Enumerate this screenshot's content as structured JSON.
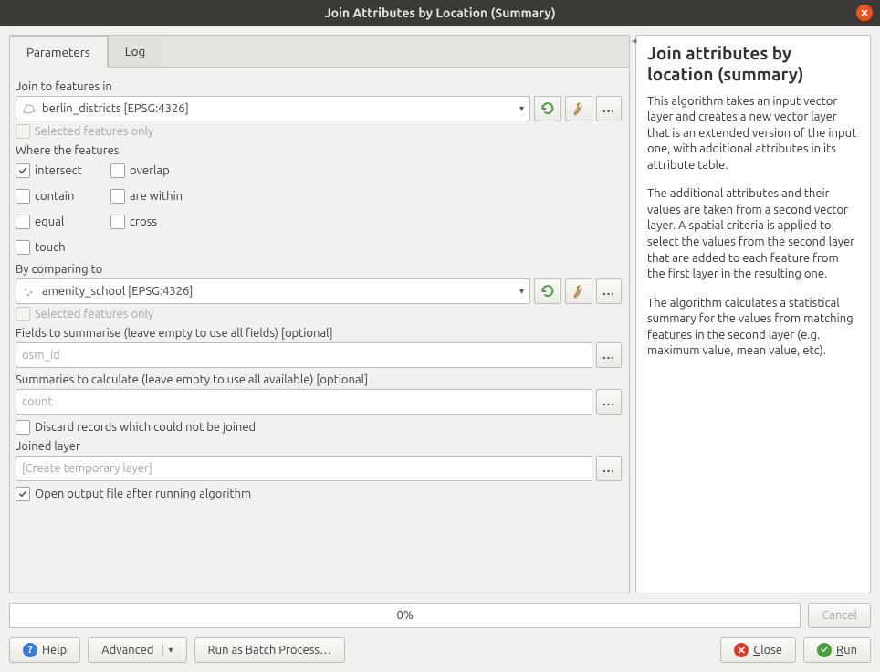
{
  "title": "Join Attributes by Location (Summary)",
  "tabs": {
    "parameters": "Parameters",
    "log": "Log"
  },
  "labels": {
    "join_to": "Join to features in",
    "selected_only": "Selected features only",
    "where": "Where the features",
    "compare_to": "By comparing to",
    "fields": "Fields to summarise (leave empty to use all fields) [optional]",
    "summaries": "Summaries to calculate (leave empty to use all available) [optional]",
    "discard": "Discard records which could not be joined",
    "joined_layer": "Joined layer",
    "open_output": "Open output file after running algorithm"
  },
  "inputs": {
    "join_layer": "berlin_districts [EPSG:4326]",
    "compare_layer": "amenity_school [EPSG:4326]",
    "fields_value": "osm_id",
    "summaries_value": "count",
    "joined_layer_placeholder": "[Create temporary layer]"
  },
  "predicates": {
    "intersect": "intersect",
    "overlap": "overlap",
    "contain": "contain",
    "are_within": "are within",
    "equal": "equal",
    "cross": "cross",
    "touch": "touch"
  },
  "help": {
    "title": "Join attributes by location (summary)",
    "p1": "This algorithm takes an input vector layer and creates a new vector layer that is an extended version of the input one, with additional attributes in its attribute table.",
    "p2": "The additional attributes and their values are taken from a second vector layer. A spatial criteria is applied to select the values from the second layer that are added to each feature from the first layer in the resulting one.",
    "p3": "The algorithm calculates a statistical summary for the values from matching features in the second layer (e.g. maximum value, mean value, etc)."
  },
  "progress": "0%",
  "buttons": {
    "cancel": "Cancel",
    "help": "Help",
    "advanced": "Advanced",
    "batch": "Run as Batch Process…",
    "close": "Close",
    "run": "Run"
  },
  "ellipsis": "…"
}
